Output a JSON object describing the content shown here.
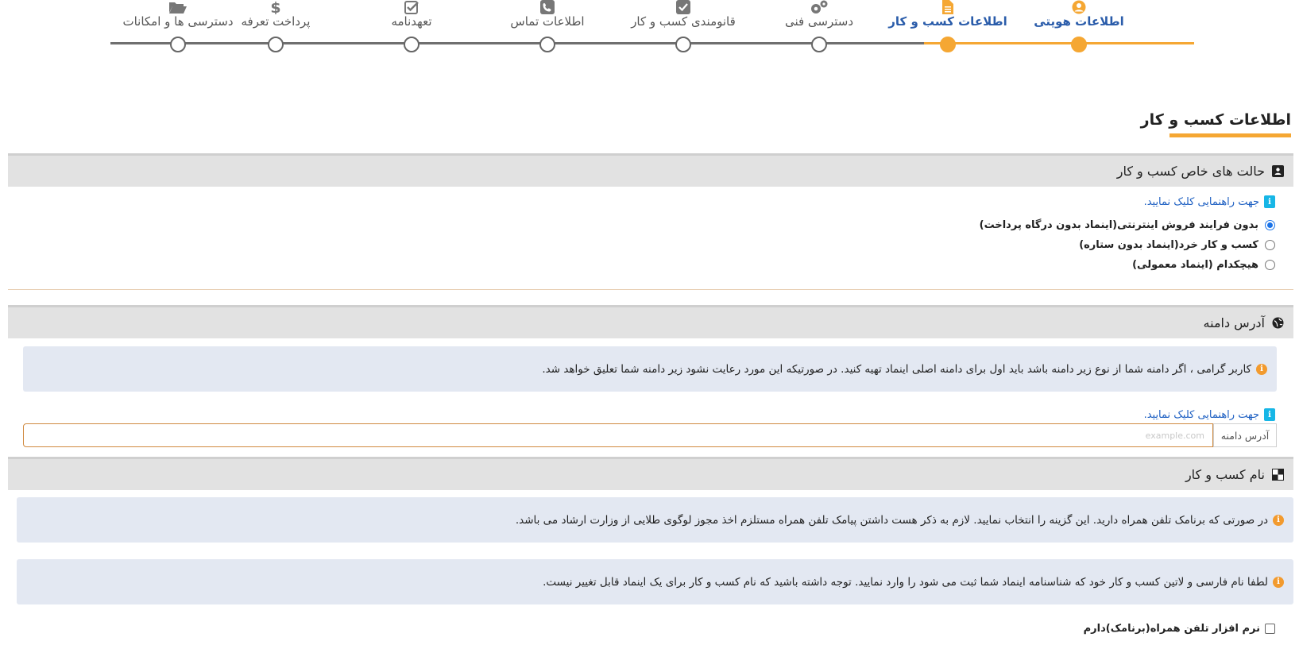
{
  "stepper": {
    "steps": [
      {
        "label": "اطلاعات هویتی",
        "icon": "user-circle-icon",
        "state": "done"
      },
      {
        "label": "اطلاعات کسب و کار",
        "icon": "document-icon",
        "state": "done"
      },
      {
        "label": "دسترسی فنی",
        "icon": "gears-icon",
        "state": "pending"
      },
      {
        "label": "قانومندی کسب و کار",
        "icon": "check-square-icon",
        "state": "pending"
      },
      {
        "label": "اطلاعات تماس",
        "icon": "phone-square-icon",
        "state": "pending"
      },
      {
        "label": "تعهدنامه",
        "icon": "check-square-outline-icon",
        "state": "pending"
      },
      {
        "label": "پرداخت تعرفه",
        "icon": "dollar-icon",
        "state": "pending"
      },
      {
        "label": "دسترسی ها و امکانات",
        "icon": "folder-open-icon",
        "state": "pending"
      }
    ]
  },
  "page_title": "اطلاعات کسب و کار",
  "special_modes": {
    "title": "حالت های خاص کسب و کار",
    "help_link": "جهت راهنمایی کلیک نمایید.",
    "options": [
      {
        "label": "بدون فرایند فروش اینترنتی(اینماد بدون درگاه پرداخت)",
        "checked": true
      },
      {
        "label": "کسب و کار خرد(اینماد بدون ستاره)",
        "checked": false
      },
      {
        "label": "هیچکدام (اینماد معمولی)",
        "checked": false
      }
    ]
  },
  "domain": {
    "title": "آدرس دامنه",
    "alert": "کاربر گرامی ، اگر دامنه شما از نوع زیر دامنه باشد باید اول برای دامنه اصلی اینماد تهیه کنید. در صورتیکه این مورد رعایت نشود زیر دامنه شما تعلیق خواهد شد.",
    "help_link": "جهت راهنمایی کلیک نمایید.",
    "input_label": "آدرس دامنه",
    "input_placeholder": "example.com",
    "input_value": ""
  },
  "business_name": {
    "title": "نام کسب و کار",
    "alert_1": "در صورتی که برنامک تلفن همراه دارید. این گزینه را انتخاب نمایید. لازم به ذکر هست داشتن پیامک تلفن همراه مستلزم اخذ مجوز لوگوی طلایی از وزارت ارشاد می باشد.",
    "alert_2": "لطفا نام فارسی و لاتین کسب و کار خود که شناسنامه اینماد شما ثبت می شود را وارد نمایید. توجه داشته باشید که نام کسب و کار برای یک اینماد قابل تغییر نیست.",
    "checkbox_label": "نرم افزار تلفن همراه(برنامک)دارم",
    "checkbox_checked": false
  },
  "colors": {
    "accent": "#f5a733",
    "link": "#1d5fc2",
    "done_label": "#2a5caa",
    "panel_header": "#e2e2e2",
    "alert_bg": "#e3e8f2"
  }
}
